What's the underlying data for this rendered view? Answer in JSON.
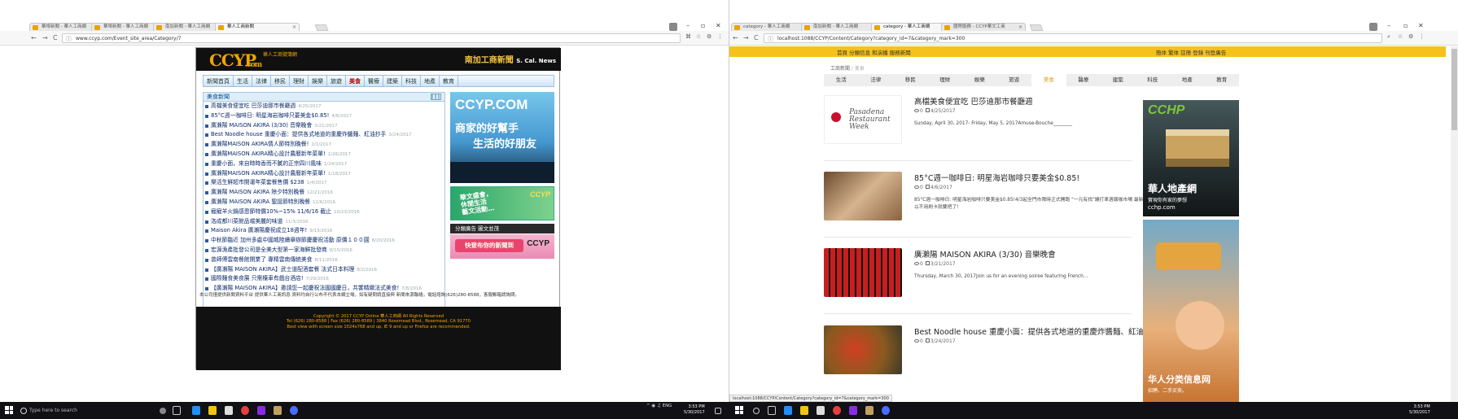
{
  "left_window": {
    "tabs": [
      {
        "label": "華埠新聞 - 華人工商網"
      },
      {
        "label": "華埠新聞 - 華人工商網"
      },
      {
        "label": "南加新聞 - 華人工商網"
      },
      {
        "label": "華人工商新聞"
      }
    ],
    "url": "www.ccyp.com/Event_site_area/Category/7",
    "page": {
      "logo": "CCYP",
      "logo_suffix": ".com",
      "logo_sub": "華人工商號簿網",
      "brand": "南加工商新聞",
      "brand_en": "S. Cal. News",
      "nav": [
        "新聞首頁",
        "生活",
        "法律",
        "移民",
        "理財",
        "娛樂",
        "旅遊",
        "美食",
        "醫療",
        "建築",
        "科技",
        "地產",
        "教育"
      ],
      "active_nav": "美食",
      "section_title": "美食新聞",
      "news": [
        {
          "title": "高檔美食便宜吃 巴莎迪那市餐廳週",
          "date": "4/25/2017"
        },
        {
          "title": "85°C週一咖啡日: 明星海岩咖啡只要美金$0.85!",
          "date": "4/6/2017"
        },
        {
          "title": "廣瀨陽 MAISON AKIRA (3/30) 音樂晚會",
          "date": "3/21/2017"
        },
        {
          "title": "Best Noodle house 重慶小面：提供各式地道的重慶炸醬麵、紅油抄手",
          "date": "3/24/2017"
        },
        {
          "title": "廣瀨陽MAISON AKIRA情人節特別晚餐!",
          "date": "2/1/2017"
        },
        {
          "title": "廣瀨陽MAISON AKIRA精心設計農曆新年菜單!",
          "date": "1/26/2017"
        },
        {
          "title": "重慶小面，來自時時香而不膩的正宗四川風味",
          "date": "1/24/2017"
        },
        {
          "title": "廣瀨陽MAISON AKIRA精心設計農曆新年菜單!",
          "date": "1/18/2017"
        },
        {
          "title": "樂活生鮮超市開運年菜套餐售價 $238",
          "date": "1/4/2017"
        },
        {
          "title": "廣瀨陽 MAISON AKIRA 除夕特別晚餐",
          "date": "12/21/2016"
        },
        {
          "title": "廣瀨陽 MAISON AKIRA 聖誕節特別晚餐",
          "date": "12/6/2016"
        },
        {
          "title": "寵寵羊火鍋感恩節特價10%~15% 11/6/16 截止",
          "date": "10/23/2016"
        },
        {
          "title": "洛成都川菜館品嚐美麗的味道",
          "date": "11/3/2016"
        },
        {
          "title": "Maison Akira 廣瀨陽慶祝成立18週年!",
          "date": "9/13/2016"
        },
        {
          "title": "中秋節臨近 加州多處中國城陸續舉辦節慶慶祝活動 原價１００圓",
          "date": "8/20/2016"
        },
        {
          "title": "宏源漁產批發公司是全美大型第一家海鮮批發商",
          "date": "8/15/2016"
        },
        {
          "title": "曾師傅雲南餐館開業了 專精雲南傳統美食",
          "date": "8/11/2016"
        },
        {
          "title": "【廣瀨陽 MAISON AKIRA】武士道配酒套餐 法式日本料理",
          "date": "8/2/2016"
        },
        {
          "title": "國際麵食美食展 只需檯車有戲台酒店!",
          "date": "7/29/2016"
        },
        {
          "title": "【廣瀨陽 MAISON AKIRA】邀請您一起慶祝法國國慶日，共饗精緻法式美食!",
          "date": "7/8/2016"
        }
      ],
      "ad_main": {
        "title": "CCYP.COM",
        "line1": "商家的好幫手",
        "line2": "生活的好朋友"
      },
      "ad_green": {
        "line1": "華文盛會，",
        "line2": "休閒生活",
        "line3": "藝文活動…",
        "brand": "CCYP"
      },
      "ad_bar": "分類廣告  圖文並茂",
      "ad_pink": {
        "label": "快登布你的新聞到",
        "brand": "CCYP"
      },
      "note": "本公司僅提供新聞資料平台 提供華人工商訊息 資料均自行公布不代表本網立場，如有疑問請直接與 新聞來源聯絡，電話諮詢(626)280-8588，客服郵箱請詢問。",
      "footer": [
        "Copyright © 2017 CCYP Online 華人工商網 All Rights Reserved",
        "Tel (626) 280-8588 | Fax (626) 280-8589 | 3840 Rosemead Blvd., Rosemead, CA 91770",
        "Best view with screen size 1024x768 and up, IE 9 and up or Firefox are recommended."
      ]
    },
    "taskbar": {
      "search_placeholder": "Type here to search",
      "time": "3:53 PM",
      "date": "5/30/2017",
      "lang": "ENG"
    }
  },
  "right_window": {
    "tabs": [
      {
        "label": "category - 華人工商網"
      },
      {
        "label": "南加新聞 - 華人工商網"
      },
      {
        "label": "category - 華人工商網"
      },
      {
        "label": "國際服務 - CCYP華文工商"
      }
    ],
    "url": "localhost:1088/CCYP/Content/Category?category_id=7&category_mark=300",
    "top_left": "首頁  分類信息  和演播  服務新聞",
    "top_right": "簡体  繁体  註冊  登錄  刊登廣告",
    "breadcrumb": {
      "home": "工商新聞",
      "current": "美食"
    },
    "nav": [
      "生活",
      "法律",
      "移民",
      "理財",
      "娛樂",
      "旅遊",
      "美食",
      "醫療",
      "建築",
      "科技",
      "地產",
      "教育"
    ],
    "active_nav": "美食",
    "items": [
      {
        "title": "高檔美食便宜吃 巴莎迪那市餐廳週",
        "views": "0",
        "date": "4/25/2017",
        "desc": "Sunday, April 30, 2017- Friday, May 5, 2017Amuse-Bouche________",
        "thumb": "Pasadena Restaurant Week"
      },
      {
        "title": "85°C週一咖啡日: 明星海岩咖啡只要美金$0.85!",
        "views": "0",
        "date": "4/6/2017",
        "desc": "85°C週一咖啡日: 明星海岩咖啡只要美金$0.85!4/3起全門市限時正式開跑 \"一元有找\"讓打車週報咖市場 最新星期一可以不用刷卡就要把了！",
        "thumb": "coffee"
      },
      {
        "title": "廣瀨陽 MAISON AKIRA (3/30) 音樂晚會",
        "views": "0",
        "date": "3/21/2017",
        "desc": "Thursday, March 30, 2017Join us for an evening soiree featuring French...",
        "thumb": "accordion"
      },
      {
        "title": "Best Noodle house 重慶小面：提供各式地道的重慶炸醬麵、紅油抄手",
        "views": "0",
        "date": "3/24/2017",
        "desc": "",
        "thumb": "noodles"
      }
    ],
    "ad1": {
      "logo": "CCHP",
      "title": "華人地產網",
      "sub": "實現你有家的夢想",
      "url": "cchp.com"
    },
    "ad2": {
      "title": "华人分类信息网",
      "sub": "招聘、二手买卖。"
    },
    "status_url": "localhost:1088/CCYP/Content/Category?category_id=7&category_mark=300",
    "taskbar": {
      "time": "3:53 PM",
      "date": "5/30/2017"
    }
  }
}
